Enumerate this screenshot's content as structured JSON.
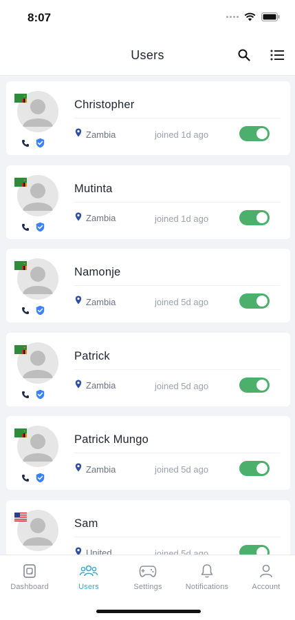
{
  "status_bar": {
    "time": "8:07"
  },
  "header": {
    "title": "Users"
  },
  "users": [
    {
      "name": "Christopher",
      "location": "Zambia",
      "joined": "joined 1d ago",
      "active": true,
      "flag": "zambia",
      "verified": true
    },
    {
      "name": "Mutinta",
      "location": "Zambia",
      "joined": "joined 1d ago",
      "active": true,
      "flag": "zambia",
      "verified": true
    },
    {
      "name": "Namonje",
      "location": "Zambia",
      "joined": "joined 5d ago",
      "active": true,
      "flag": "zambia",
      "verified": true
    },
    {
      "name": "Patrick",
      "location": "Zambia",
      "joined": "joined 5d ago",
      "active": true,
      "flag": "zambia",
      "verified": true
    },
    {
      "name": "Patrick Mungo",
      "location": "Zambia",
      "joined": "joined 5d ago",
      "active": true,
      "flag": "zambia",
      "verified": true
    },
    {
      "name": "Sam",
      "location": "United",
      "joined": "joined 5d ago",
      "active": true,
      "flag": "usa",
      "verified": false
    }
  ],
  "nav": {
    "items": [
      {
        "label": "Dashboard",
        "icon": "dashboard-icon",
        "active": false
      },
      {
        "label": "Users",
        "icon": "users-icon",
        "active": true
      },
      {
        "label": "Settings",
        "icon": "settings-icon",
        "active": false
      },
      {
        "label": "Notifications",
        "icon": "bell-icon",
        "active": false
      },
      {
        "label": "Account",
        "icon": "account-icon",
        "active": false
      }
    ]
  },
  "colors": {
    "accent": "#3aa6c9",
    "toggle_on": "#4caf6c",
    "verified": "#3b82f6",
    "location_pin": "#2f4fa2"
  }
}
